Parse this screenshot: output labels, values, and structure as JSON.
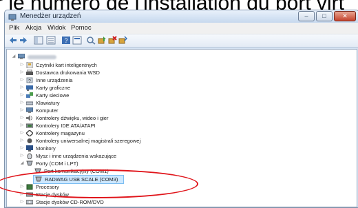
{
  "caption": "r le numéro de l'installation du port virt",
  "window": {
    "title": "Menedżer urządzeń",
    "controls": [
      "–",
      "□",
      "✕"
    ]
  },
  "menu": [
    "Plik",
    "Akcja",
    "Widok",
    "Pomoc"
  ],
  "toolbar_icons": [
    "back-icon",
    "forward-icon",
    "show-hide-tree-icon",
    "list-icon",
    "help-icon",
    "properties-icon",
    "scan-hardware-icon",
    "update-driver-icon",
    "uninstall-icon",
    "disable-icon"
  ],
  "tree": {
    "root_expander": "◢",
    "collapsed_expander": "▷",
    "expanded_expander": "◢",
    "categories": [
      "Czytniki kart inteligentnych",
      "Dostawca drukowania WSD",
      "Inne urządzenia",
      "Karty graficzne",
      "Karty sieciowe",
      "Klawiatury",
      "Komputer",
      "Kontrolery dźwięku, wideo i gier",
      "Kontrolery IDE ATA/ATAPI",
      "Kontrolery magazynu",
      "Kontrolery uniwersalnej magistrali szeregowej",
      "Monitory",
      "Mysz i inne urządzenia wskazujące",
      "Porty (COM i LPT)"
    ],
    "ports_children": [
      "Port komunikacyjny (COM1)",
      "RADWAG USB SCALE (COM3)"
    ],
    "after_ports": [
      "Procesory",
      "Stacje dysków",
      "Stacje dysków CD-ROM/DVD"
    ]
  },
  "colors": {
    "highlight_ring": "#e0151b",
    "selection": "#cde8ff"
  }
}
